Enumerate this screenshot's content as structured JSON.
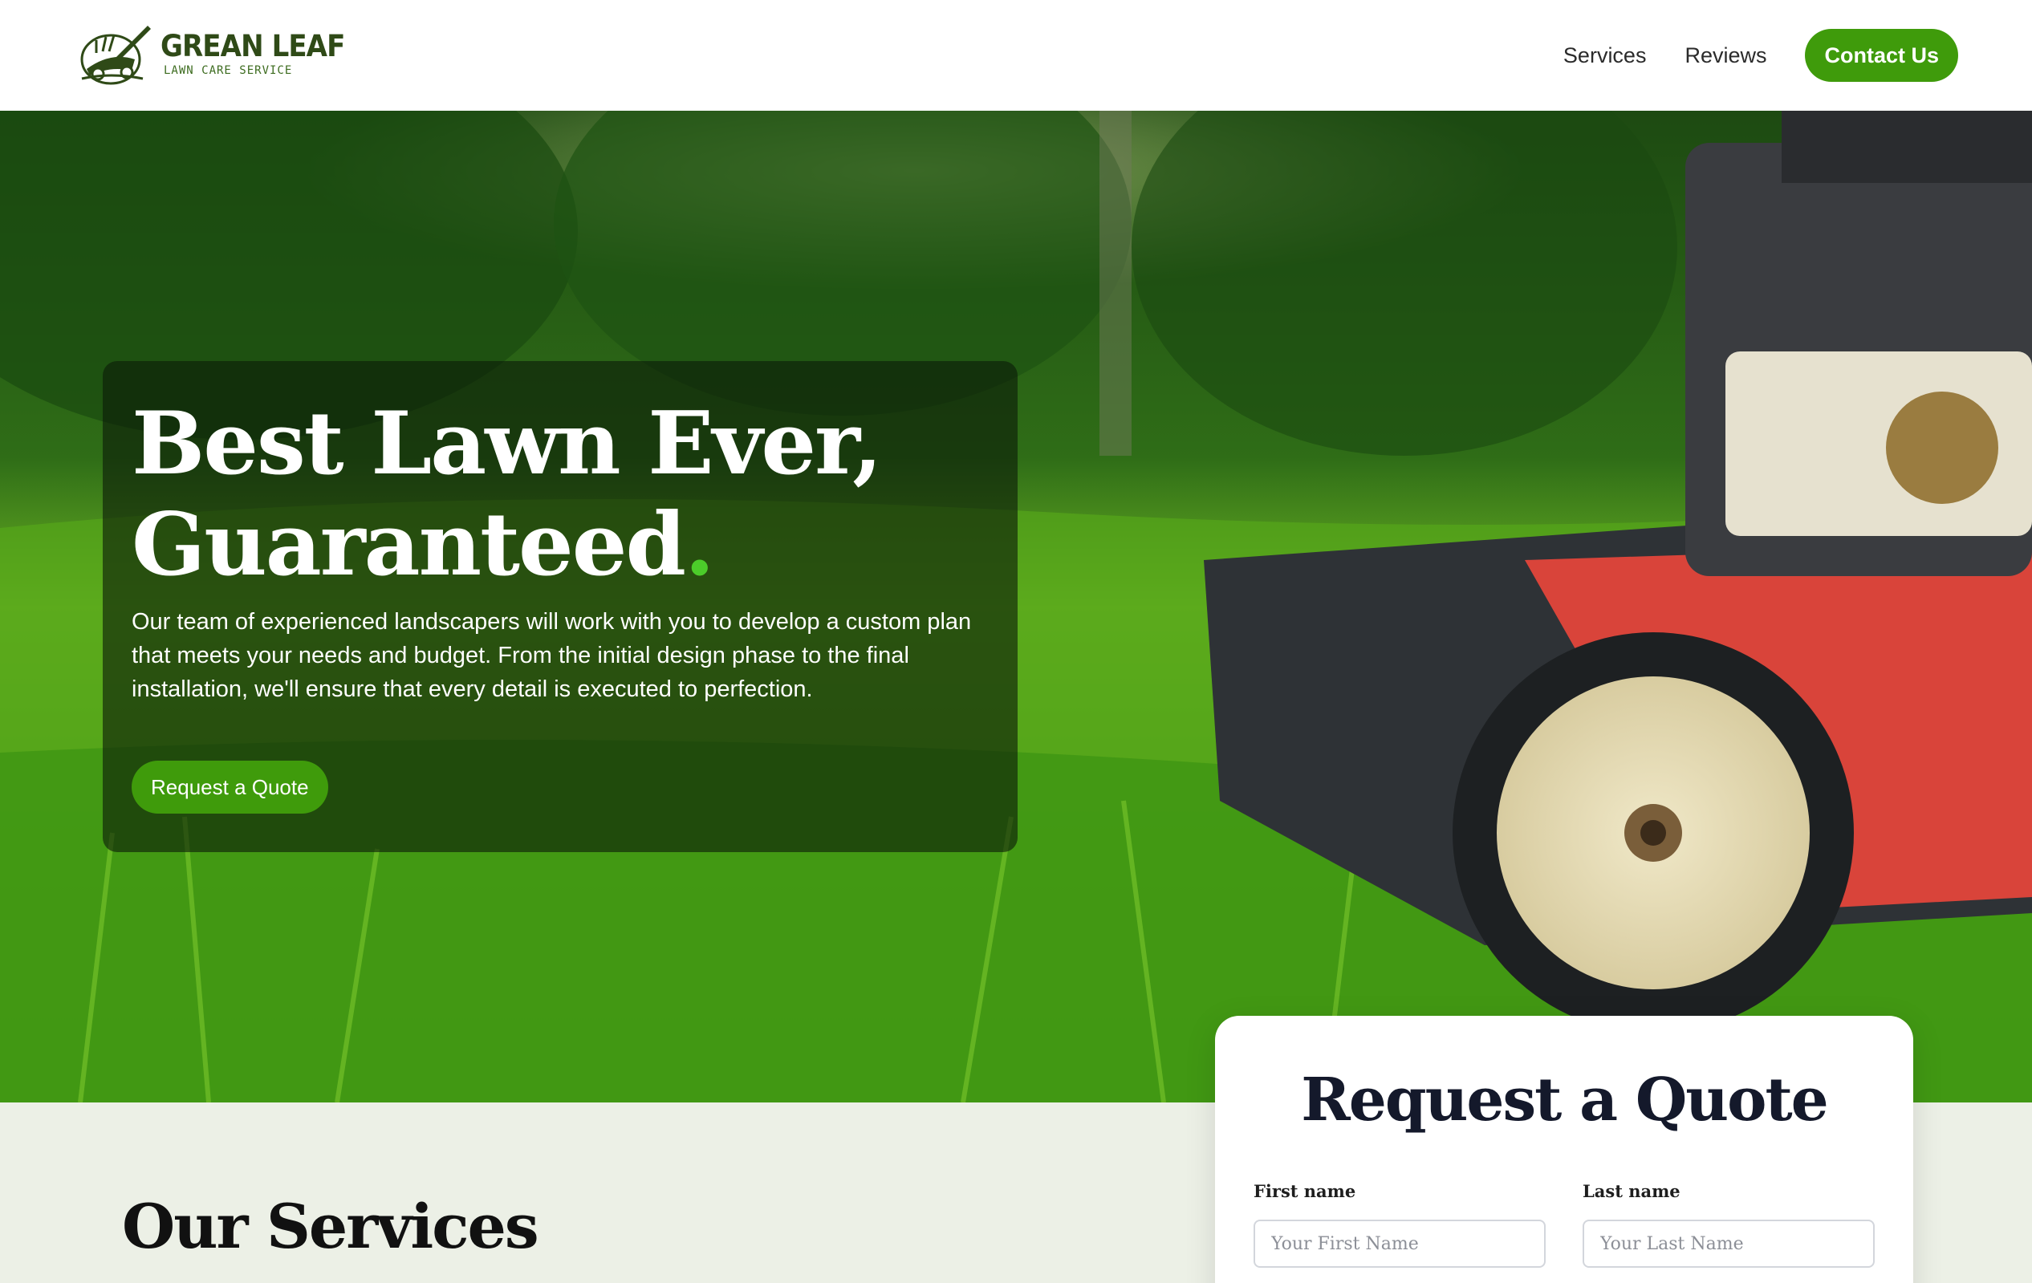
{
  "header": {
    "logo_title": "GREAN LEAF",
    "logo_subtitle": "LAWN CARE SERVICE",
    "nav": [
      {
        "label": "Services"
      },
      {
        "label": "Reviews"
      }
    ],
    "contact_label": "Contact Us"
  },
  "hero": {
    "title_line1": "Best Lawn Ever,",
    "title_line2": "Guaranteed",
    "title_dot": ".",
    "description": "Our team of experienced landscapers will work with you to develop a custom plan that meets your needs and budget. From the initial design phase to the final installation, we'll ensure that every detail is executed to perfection.",
    "cta_label": "Request a Quote"
  },
  "services": {
    "title": "Our Services"
  },
  "quote_form": {
    "title": "Request a Quote",
    "first_name_label": "First name",
    "first_name_placeholder": "Your First Name",
    "last_name_label": "Last name",
    "last_name_placeholder": "Your Last Name"
  },
  "colors": {
    "accent_green": "#3f9b0b",
    "dot_green": "#4ccc2a",
    "logo_green": "#2f4a17",
    "section_bg": "#ecf0e6"
  }
}
